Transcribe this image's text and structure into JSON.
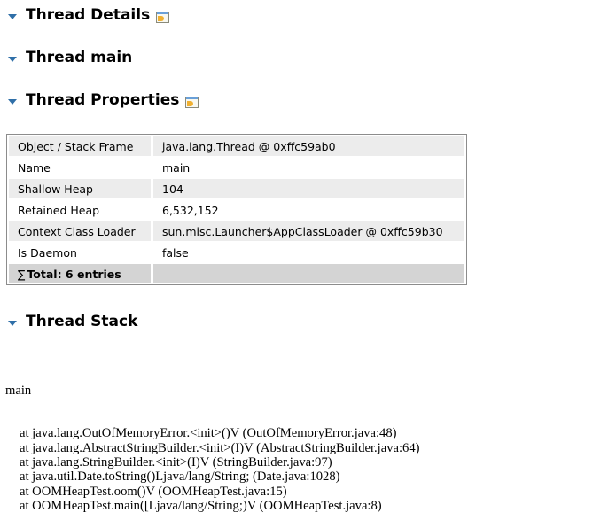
{
  "sections": {
    "details": {
      "title": "Thread Details",
      "icon": "view-details-icon"
    },
    "main": {
      "title": "Thread main"
    },
    "properties": {
      "title": "Thread Properties",
      "icon": "view-details-icon"
    },
    "stack": {
      "title": "Thread Stack"
    }
  },
  "properties_table": {
    "rows": [
      {
        "key": "Object / Stack Frame",
        "value": "java.lang.Thread @ 0xffc59ab0"
      },
      {
        "key": "Name",
        "value": "main"
      },
      {
        "key": "Shallow Heap",
        "value": "104"
      },
      {
        "key": "Retained Heap",
        "value": "6,532,152"
      },
      {
        "key": "Context Class Loader",
        "value": "sun.misc.Launcher$AppClassLoader @ 0xffc59b30"
      },
      {
        "key": "Is Daemon",
        "value": "false"
      }
    ],
    "total_symbol": "∑",
    "total_label": "Total: 6 entries"
  },
  "thread_stack": {
    "thread_name": "main",
    "frames": [
      "at java.lang.OutOfMemoryError.<init>()V (OutOfMemoryError.java:48)",
      "at java.lang.AbstractStringBuilder.<init>(I)V (AbstractStringBuilder.java:64)",
      "at java.lang.StringBuilder.<init>(I)V (StringBuilder.java:97)",
      "at java.util.Date.toString()Ljava/lang/String; (Date.java:1028)",
      "at OOMHeapTest.oom()V (OOMHeapTest.java:15)",
      "at OOMHeapTest.main([Ljava/lang/String;)V (OOMHeapTest.java:8)"
    ]
  }
}
